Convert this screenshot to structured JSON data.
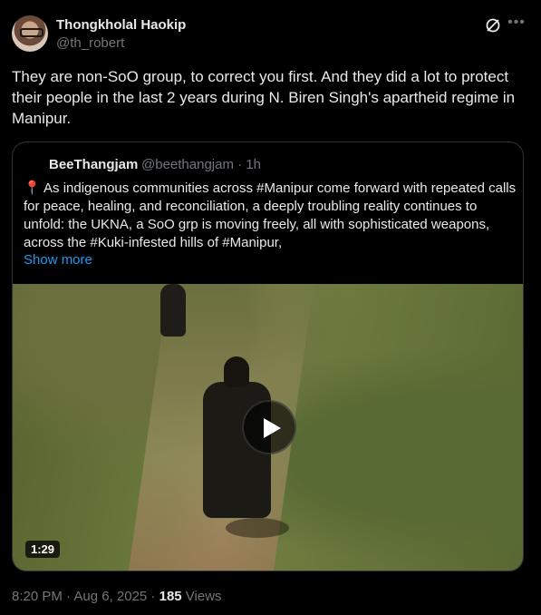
{
  "tweet": {
    "display_name": "Thongkholal Haokip",
    "handle": "@th_robert",
    "text": "They are non-SoO group, to correct you first. And they did a lot to protect their people in the last 2 years during N. Biren Singh's apartheid regime in Manipur."
  },
  "quote": {
    "display_name": "BeeThangjam",
    "handle": "@beethangjam · 1h",
    "pin_emoji": "📍",
    "text": "As indigenous communities across #Manipur come forward with repeated calls for peace, healing, and reconciliation, a deeply troubling reality continues to unfold: the UKNA, a SoO grp is moving freely, all with sophisticated weapons, across the #Kuki-infested hills of #Manipur,",
    "show_more": "Show more",
    "video_duration": "1:29"
  },
  "footer": {
    "timestamp": "8:20 PM · Aug 6, 2025 · ",
    "views_count": "185",
    "views_label": " Views"
  },
  "icons": {
    "grok": "grok-icon",
    "more": "more-icon",
    "play": "play-icon"
  },
  "colors": {
    "background": "#000000",
    "link": "#1d9bf0",
    "secondary_text": "#71767b",
    "border": "#2f3336"
  }
}
